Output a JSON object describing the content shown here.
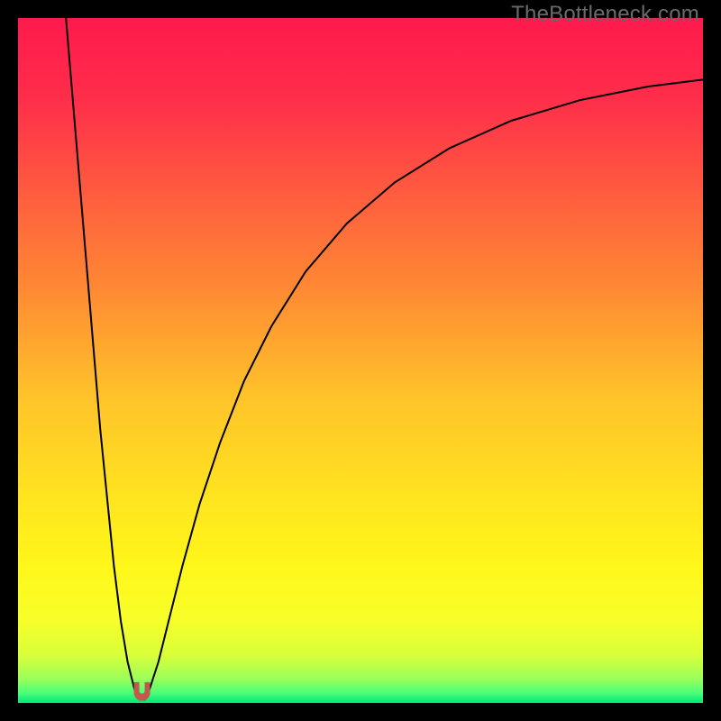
{
  "watermark": "TheBottleneck.com",
  "chart_data": {
    "type": "line",
    "title": "",
    "xlabel": "",
    "ylabel": "",
    "xlim": [
      0,
      100
    ],
    "ylim": [
      0,
      100
    ],
    "grid": false,
    "legend": false,
    "background_gradient": {
      "stops": [
        {
          "offset": 0.0,
          "color": "#ff1a4d"
        },
        {
          "offset": 0.12,
          "color": "#ff2e4a"
        },
        {
          "offset": 0.25,
          "color": "#ff5a3f"
        },
        {
          "offset": 0.4,
          "color": "#ff8b33"
        },
        {
          "offset": 0.55,
          "color": "#ffc22a"
        },
        {
          "offset": 0.7,
          "color": "#ffe41f"
        },
        {
          "offset": 0.8,
          "color": "#fff71a"
        },
        {
          "offset": 0.88,
          "color": "#f7ff2a"
        },
        {
          "offset": 0.93,
          "color": "#d9ff3a"
        },
        {
          "offset": 0.965,
          "color": "#9bff5a"
        },
        {
          "offset": 0.985,
          "color": "#4dff7a"
        },
        {
          "offset": 1.0,
          "color": "#00e676"
        }
      ]
    },
    "series": [
      {
        "name": "bottleneck-curve",
        "stroke": "#000000",
        "stroke_width": 2,
        "points": [
          {
            "x": 7.0,
            "y": 100.0
          },
          {
            "x": 8.0,
            "y": 88.0
          },
          {
            "x": 9.0,
            "y": 76.0
          },
          {
            "x": 10.0,
            "y": 64.0
          },
          {
            "x": 11.0,
            "y": 52.0
          },
          {
            "x": 12.0,
            "y": 40.0
          },
          {
            "x": 13.0,
            "y": 30.0
          },
          {
            "x": 14.0,
            "y": 20.0
          },
          {
            "x": 15.0,
            "y": 12.0
          },
          {
            "x": 16.0,
            "y": 6.0
          },
          {
            "x": 17.0,
            "y": 2.0
          },
          {
            "x": 17.8,
            "y": 0.5
          },
          {
            "x": 18.5,
            "y": 0.5
          },
          {
            "x": 19.2,
            "y": 2.0
          },
          {
            "x": 20.5,
            "y": 6.0
          },
          {
            "x": 22.0,
            "y": 12.0
          },
          {
            "x": 24.0,
            "y": 20.0
          },
          {
            "x": 26.5,
            "y": 29.0
          },
          {
            "x": 29.5,
            "y": 38.0
          },
          {
            "x": 33.0,
            "y": 47.0
          },
          {
            "x": 37.0,
            "y": 55.0
          },
          {
            "x": 42.0,
            "y": 63.0
          },
          {
            "x": 48.0,
            "y": 70.0
          },
          {
            "x": 55.0,
            "y": 76.0
          },
          {
            "x": 63.0,
            "y": 81.0
          },
          {
            "x": 72.0,
            "y": 85.0
          },
          {
            "x": 82.0,
            "y": 88.0
          },
          {
            "x": 92.0,
            "y": 90.0
          },
          {
            "x": 100.0,
            "y": 91.0
          }
        ]
      }
    ],
    "marker": {
      "name": "optimum-marker",
      "x": 18.1,
      "y": 1.5,
      "shape": "u-rounded",
      "color": "#c15a4a"
    }
  }
}
